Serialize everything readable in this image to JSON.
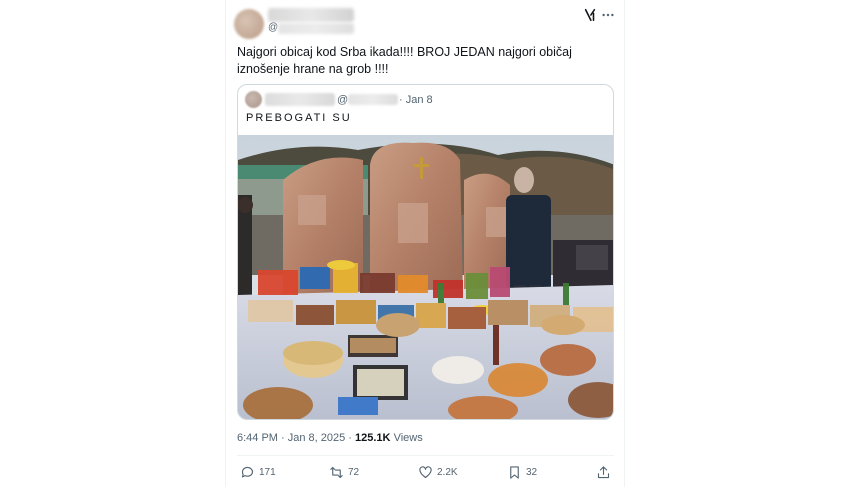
{
  "tweet": {
    "handle_prefix": "@",
    "text": "Najgori obicaj kod Srba ikada!!!! BROJ JEDAN najgori običaj iznošenje hrane na grob !!!!",
    "timestamp": "6:44 PM · Jan 8, 2025 · ",
    "views_count": "125.1K",
    "views_label": "Views"
  },
  "quote": {
    "handle_prefix": "@",
    "date": "· Jan 8",
    "text": "PREBOGATI SU"
  },
  "actions": {
    "replies": "171",
    "reposts": "72",
    "likes": "2.2K",
    "bookmarks": "32"
  },
  "icons": {
    "header": [
      "grok-icon",
      "more-icon"
    ],
    "actions": [
      "reply-icon",
      "repost-icon",
      "like-icon",
      "bookmark-icon",
      "share-icon"
    ]
  },
  "colors": {
    "text": "#0f1419",
    "secondary": "#536471",
    "border": "#cfd9de"
  }
}
